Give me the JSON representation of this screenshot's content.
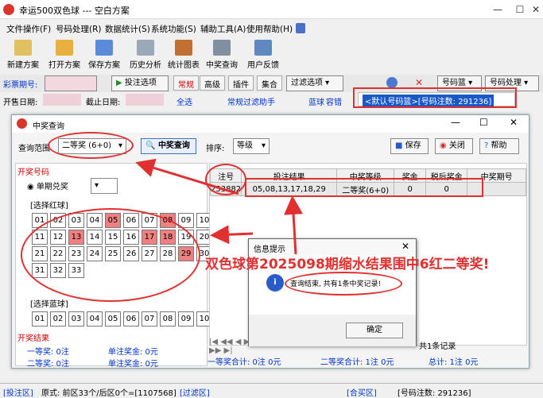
{
  "app": {
    "title": "幸运500双色球 --- 空白方案"
  },
  "menu": [
    "文件操作(F)",
    "号码处理(R)",
    "数据统计(S)",
    "系统功能(S)",
    "辅助工具(A)",
    "使用帮助(H)"
  ],
  "toolbar": [
    "新建方案",
    "打开方案",
    "保存方案",
    "历史分析",
    "统计图表",
    "中奖查询",
    "用户反馈"
  ],
  "row1": {
    "period_label": "彩票期号:",
    "bet_btn": "投注选项",
    "tabs": [
      "常规",
      "高级",
      "插件",
      "集合"
    ],
    "filter_btn": "过滤选项",
    "pool_btn": "号码篮",
    "proc_btn": "号码处理"
  },
  "row2": {
    "open_date": "开售日期:",
    "close_date": "截止日期:",
    "select_all": "全选",
    "filter_hand": "常规过滤助手",
    "basket": "蓝球",
    "container": "容错",
    "list_item": "<默认号码篮>[号码注数: 291236]"
  },
  "dialog": {
    "title": "中奖查询",
    "range_label": "查询范围",
    "range_value": "二等奖 (6+0)",
    "query_btn": "中奖查询",
    "sort_label": "排序:",
    "sort_value": "等级",
    "save_btn": "保存",
    "close_btn": "关闭",
    "help_btn": "帮助",
    "open_num_title": "开奖号码",
    "single_period": "单期兑奖",
    "red_title": "[选择红球]",
    "blue_title": "[选择蓝球]",
    "result_title": "开奖结果",
    "r1": "一等奖: 0注",
    "r2": "单注奖金: 0元",
    "r3": "二等奖: 0注",
    "r4": "单注奖金: 0元"
  },
  "red_balls": [
    "01",
    "02",
    "03",
    "04",
    "05",
    "06",
    "07",
    "08",
    "09",
    "10",
    "11",
    "12",
    "13",
    "14",
    "15",
    "16",
    "17",
    "18",
    "19",
    "20",
    "21",
    "22",
    "23",
    "24",
    "25",
    "26",
    "27",
    "28",
    "29",
    "30",
    "31",
    "32",
    "33"
  ],
  "red_hits": [
    "05",
    "08",
    "13",
    "17",
    "18",
    "29"
  ],
  "blue_balls": [
    "01",
    "02",
    "03",
    "04",
    "05",
    "06",
    "07",
    "08",
    "09",
    "10"
  ],
  "table": {
    "headers": [
      "注号",
      "投注结果",
      "中奖等级",
      "奖金",
      "税后奖金",
      "中奖期号"
    ],
    "row": [
      "253882",
      "05,08,13,17,18,29",
      "二等奖(6+0)",
      "0",
      "0",
      ""
    ]
  },
  "summary": {
    "a": "一等奖合计: 0注  0元",
    "b": "二等奖合计: 1注  0元",
    "c": "总计: 1注  0元",
    "d": "共1条记录"
  },
  "info": {
    "title": "信息提示",
    "message": "查询结束, 共有1条中奖记录!",
    "ok": "确定"
  },
  "annotation": "双色球第2025098期缩水结果围中6红二等奖!",
  "status": {
    "left": "[投注区]",
    "mid": "原式: 前区33个/后区0个=[1107568]",
    "filter": "[过滤区]",
    "buy": "[合买区]",
    "count": "[号码注数: 291236]"
  },
  "colors": {
    "accent": "#d9352b",
    "annotation": "#e03030",
    "hit": "#f08080"
  }
}
